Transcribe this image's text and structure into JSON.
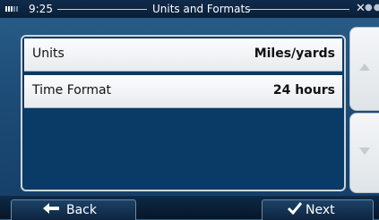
{
  "status": {
    "time": "9:25",
    "title": "Units and Formats"
  },
  "rows": [
    {
      "label": "Units",
      "value": "Miles/yards"
    },
    {
      "label": "Time Format",
      "value": "24 hours"
    }
  ],
  "footer": {
    "back_label": "Back",
    "next_label": "Next"
  },
  "icons": {
    "signal": "signal-icon",
    "satellite": "satellite-icon",
    "back": "back-arrow-icon",
    "next": "checkmark-icon",
    "scroll_up": "scroll-up-icon",
    "scroll_down": "scroll-down-icon"
  },
  "colors": {
    "panel": "#0a3a66",
    "background": "#1d4d78"
  }
}
